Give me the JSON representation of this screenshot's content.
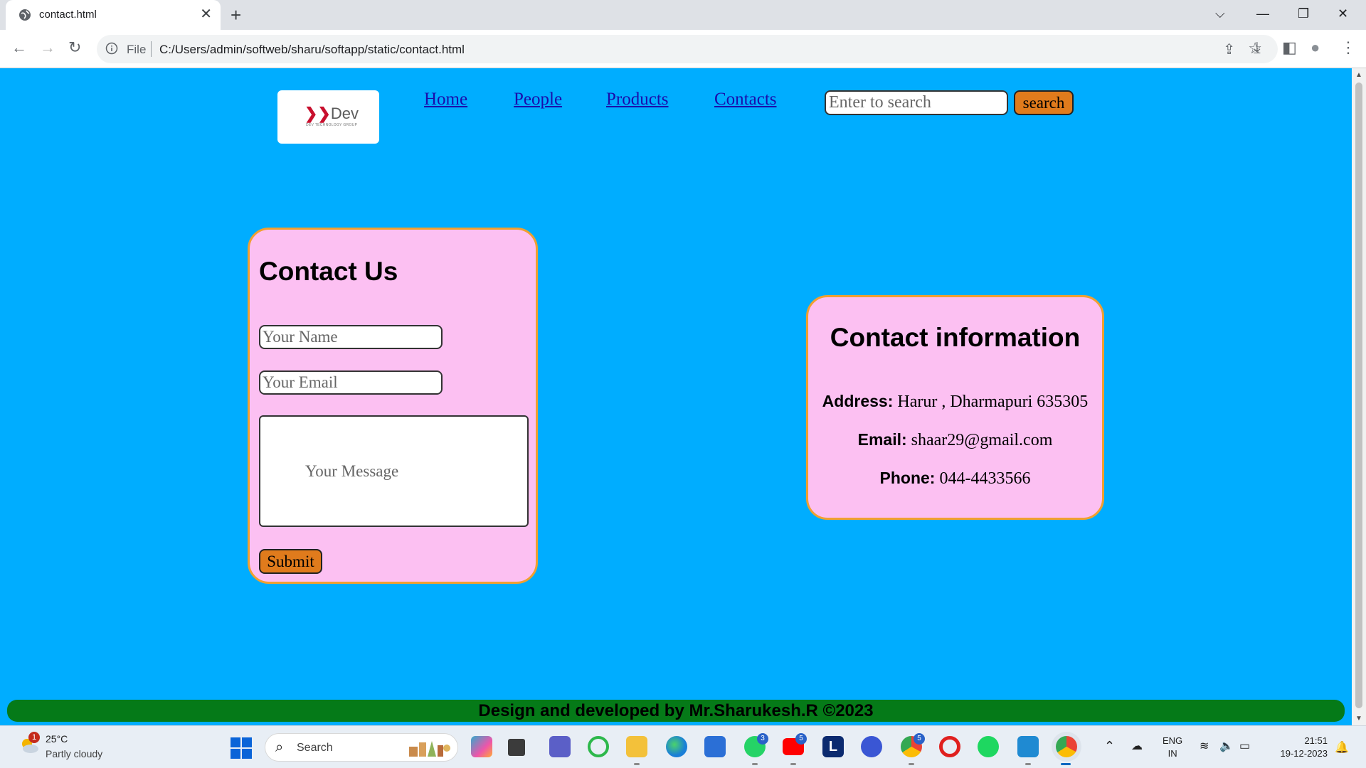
{
  "browser": {
    "tab_title": "contact.html",
    "tab_close": "✕",
    "new_tab": "+",
    "address_scheme": "File",
    "address_url": "C:/Users/admin/softweb/sharu/softapp/static/contact.html",
    "window_controls": {
      "dropdown": "⌵",
      "minimize": "—",
      "restore": "❐",
      "close": "✕"
    },
    "nav": {
      "back": "←",
      "forward": "→",
      "reload": "↻"
    },
    "icons": {
      "share": "⇪",
      "star": "☆",
      "download": "⤓",
      "sidepanel": "◧",
      "profile": "●",
      "menu": "⋮"
    }
  },
  "site": {
    "logo": {
      "mark": "Dev",
      "tagline": "DEV TECHNOLOGY GROUP"
    },
    "nav": [
      "Home",
      "People",
      "Products",
      "Contacts"
    ],
    "search": {
      "placeholder": "Enter to search",
      "button": "search"
    }
  },
  "contact_form": {
    "title": "Contact Us",
    "name_placeholder": "Your Name",
    "email_placeholder": "Your Email",
    "message_placeholder": "Your Message",
    "submit": "Submit"
  },
  "contact_info": {
    "title": "Contact information",
    "address_label": "Address:",
    "address_value": "Harur , Dharmapuri 635305",
    "email_label": "Email:",
    "email_value": "shaar29@gmail.com",
    "phone_label": "Phone:",
    "phone_value": "044-4433566"
  },
  "footer": {
    "text": "Design and developed by Mr.Sharukesh.R ©2023"
  },
  "taskbar": {
    "weather_temp": "25°C",
    "weather_desc": "Partly cloudy",
    "weather_badge": "1",
    "search_label": "Search",
    "badges": {
      "whatsapp": "3",
      "youtube": "5",
      "chrome_profile": "5"
    },
    "lang_line1": "ENG",
    "lang_line2": "IN",
    "time": "21:51",
    "date": "19-12-2023"
  }
}
